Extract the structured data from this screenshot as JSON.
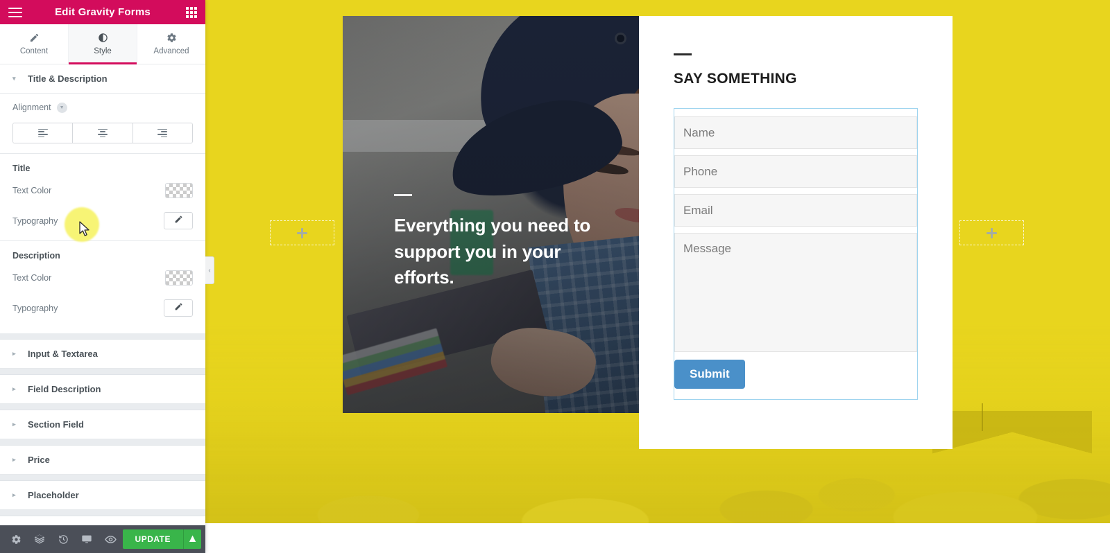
{
  "panel": {
    "header": {
      "title": "Edit Gravity Forms",
      "menu_icon": "hamburger-icon",
      "widgets_icon": "grid-icon"
    },
    "tabs": [
      {
        "label": "Content",
        "icon": "pencil-icon",
        "active": false
      },
      {
        "label": "Style",
        "icon": "contrast-icon",
        "active": true
      },
      {
        "label": "Advanced",
        "icon": "gear-icon",
        "active": false
      }
    ],
    "open_section": {
      "title": "Title & Description",
      "caret": "▾",
      "alignment": {
        "label": "Alignment",
        "responsive_icon": "device-toggle-icon",
        "options": [
          "align-left",
          "align-center",
          "align-right"
        ]
      },
      "title_group": {
        "label": "Title",
        "text_color_label": "Text Color",
        "text_color_value": "transparent",
        "typography_label": "Typography",
        "typography_icon": "pencil-edit-icon"
      },
      "description_group": {
        "label": "Description",
        "text_color_label": "Text Color",
        "text_color_value": "transparent",
        "typography_label": "Typography",
        "typography_icon": "pencil-edit-icon"
      }
    },
    "collapsed_sections": [
      {
        "title": "Input & Textarea",
        "caret": "▸"
      },
      {
        "title": "Field Description",
        "caret": "▸"
      },
      {
        "title": "Section Field",
        "caret": "▸"
      },
      {
        "title": "Price",
        "caret": "▸"
      },
      {
        "title": "Placeholder",
        "caret": "▸"
      }
    ],
    "footer": {
      "icons": [
        "gear-icon",
        "layers-icon",
        "history-icon",
        "responsive-icon",
        "preview-eye-icon"
      ],
      "update_label": "UPDATE",
      "update_caret": "▲"
    },
    "collapse_handle": "‹"
  },
  "canvas": {
    "add_boxes": [
      {
        "icon": "plus-icon"
      },
      {
        "icon": "plus-icon"
      }
    ],
    "hero": {
      "heading": "Everything you need to support you in your efforts."
    },
    "form": {
      "title": "SAY SOMETHING",
      "fields": [
        {
          "name": "name",
          "placeholder": "Name"
        },
        {
          "name": "phone",
          "placeholder": "Phone"
        },
        {
          "name": "email",
          "placeholder": "Email"
        },
        {
          "name": "message",
          "placeholder": "Message"
        }
      ],
      "submit_label": "Submit"
    }
  },
  "colors": {
    "brand_pink": "#d30c5c",
    "update_green": "#39b54a",
    "canvas_yellow": "#e8d51e",
    "submit_blue": "#4a90c9",
    "selection_blue": "#9fd4ef",
    "footer_dark": "#4b4f58"
  }
}
